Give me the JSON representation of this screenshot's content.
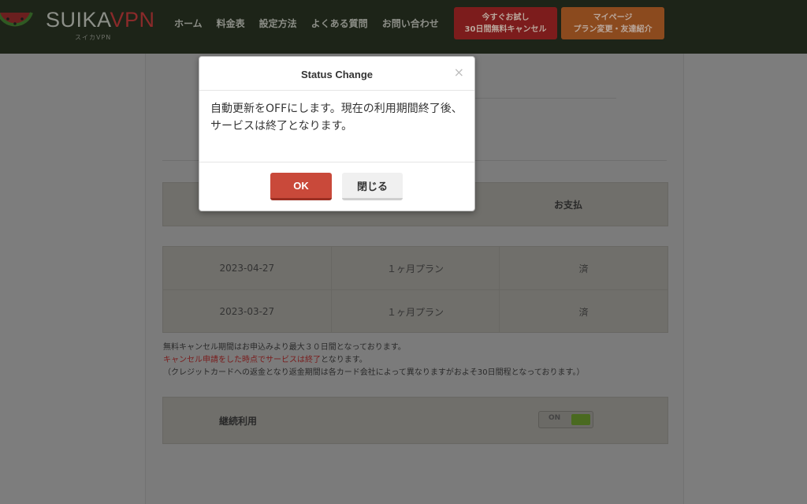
{
  "header": {
    "brand_main": "SUIKA",
    "brand_accent": "VPN",
    "brand_sub": "スイカVPN",
    "nav": [
      "ホーム",
      "料金表",
      "設定方法",
      "よくある質問",
      "お問い合わせ"
    ],
    "trial_button": {
      "line1": "今すぐお試し",
      "line2": "30日間無料キャンセル"
    },
    "mypage_button": {
      "line1": "マイページ",
      "line2": "プラン変更・友達紹介"
    }
  },
  "table": {
    "header_payment": "お支払",
    "rows": [
      {
        "date": "2023-04-27",
        "plan": "１ヶ月プラン",
        "status": "済"
      },
      {
        "date": "2023-03-27",
        "plan": "１ヶ月プラン",
        "status": "済"
      }
    ]
  },
  "notes": {
    "line1": "無料キャンセル期間はお申込みより最大３０日間となっております。",
    "line2_red": "キャンセル申請をした時点でサービスは終了",
    "line2_rest": "となります。",
    "line3": "（クレジットカードへの返金となり返金期間は各カード会社によって異なりますがおよそ30日間程となっております。）"
  },
  "continuation": {
    "label": "継続利用",
    "toggle_label": "ON"
  },
  "modal": {
    "title": "Status Change",
    "close_glyph": "×",
    "body": "自動更新をOFFにします。現在の利用期間終了後、サービスは終了となります。",
    "ok_label": "OK",
    "close_label": "閉じる"
  },
  "colors": {
    "ok_button": "#c9493a",
    "header_bg": "#1d2418",
    "trial_button": "#7c1c1c",
    "mypage_button": "#8b4a1e",
    "toggle_on": "#4a6a20"
  },
  "icons": {
    "logo": "watermelon-icon",
    "close": "close-icon"
  }
}
